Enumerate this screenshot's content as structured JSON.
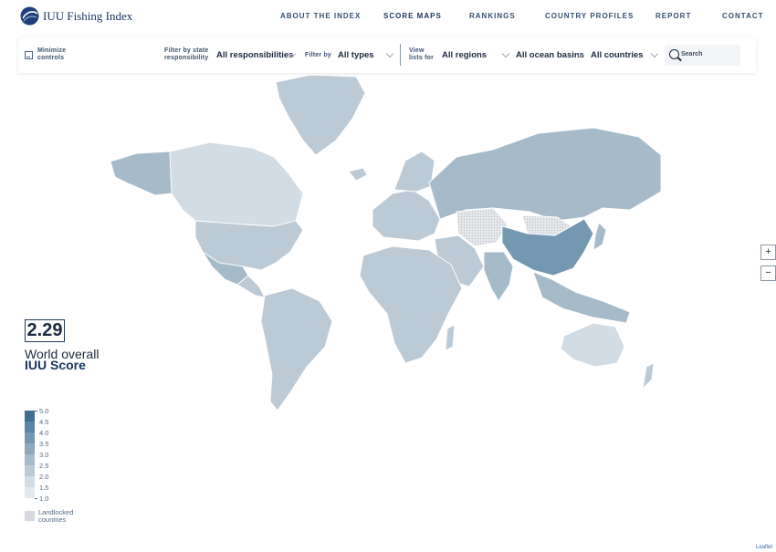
{
  "header": {
    "logo_text": "IUU Fishing Index",
    "nav": [
      "ABOUT THE INDEX",
      "SCORE MAPS",
      "RANKINGS",
      "COUNTRY PROFILES",
      "REPORT",
      "CONTACT"
    ],
    "active_nav": "SCORE MAPS"
  },
  "filters": {
    "minimize_label": "Minimize controls",
    "state_label": "Filter by state responsibility",
    "state_value": "All responsibilities",
    "type_label": "Filter by",
    "type_value": "All types",
    "view_label": "View lists for",
    "regions_value": "All regions",
    "ocean_value": "All ocean basins",
    "countries_value": "All countries",
    "search_placeholder": "Search"
  },
  "score": {
    "value": "2.29",
    "line1": "World overall",
    "line2": "IUU Score"
  },
  "legend": {
    "labels": [
      "5.0",
      "4.5",
      "4.0",
      "3.5",
      "3.0",
      "2.5",
      "2.0",
      "1.5",
      "1.0"
    ],
    "colors": [
      "#3f6f92",
      "#5b86a5",
      "#7598b2",
      "#8ea9bd",
      "#a6bbca",
      "#bccad6",
      "#d1dce4",
      "#e3eaef",
      "#f2f5f7"
    ],
    "landlocked_label": "Landlocked countries",
    "landlocked_color": "#d6d8db"
  },
  "map": {
    "regions": [
      {
        "name": "Alaska",
        "score": 2.8
      },
      {
        "name": "Canada",
        "score": 2.2
      },
      {
        "name": "Greenland",
        "score": 2.4
      },
      {
        "name": "United States",
        "score": 2.7
      },
      {
        "name": "Mexico",
        "score": 2.8
      },
      {
        "name": "Central America",
        "score": 2.6
      },
      {
        "name": "South America",
        "score": 2.7
      },
      {
        "name": "Europe",
        "score": 2.3
      },
      {
        "name": "Scandinavia",
        "score": 2.4
      },
      {
        "name": "Russia",
        "score": 3.1
      },
      {
        "name": "Central Asia",
        "score": 0
      },
      {
        "name": "Mongolia",
        "score": 0
      },
      {
        "name": "China",
        "score": 3.9
      },
      {
        "name": "Japan",
        "score": 3.0
      },
      {
        "name": "Middle East",
        "score": 2.6
      },
      {
        "name": "India",
        "score": 2.9
      },
      {
        "name": "Southeast Asia",
        "score": 3.0
      },
      {
        "name": "Africa",
        "score": 2.6
      },
      {
        "name": "Madagascar",
        "score": 2.4
      },
      {
        "name": "Australia",
        "score": 2.2
      },
      {
        "name": "New Zealand",
        "score": 2.3
      },
      {
        "name": "Iceland",
        "score": 2.3
      }
    ]
  },
  "zoom": {
    "in": "+",
    "out": "−"
  },
  "attribution": "Leaflet"
}
